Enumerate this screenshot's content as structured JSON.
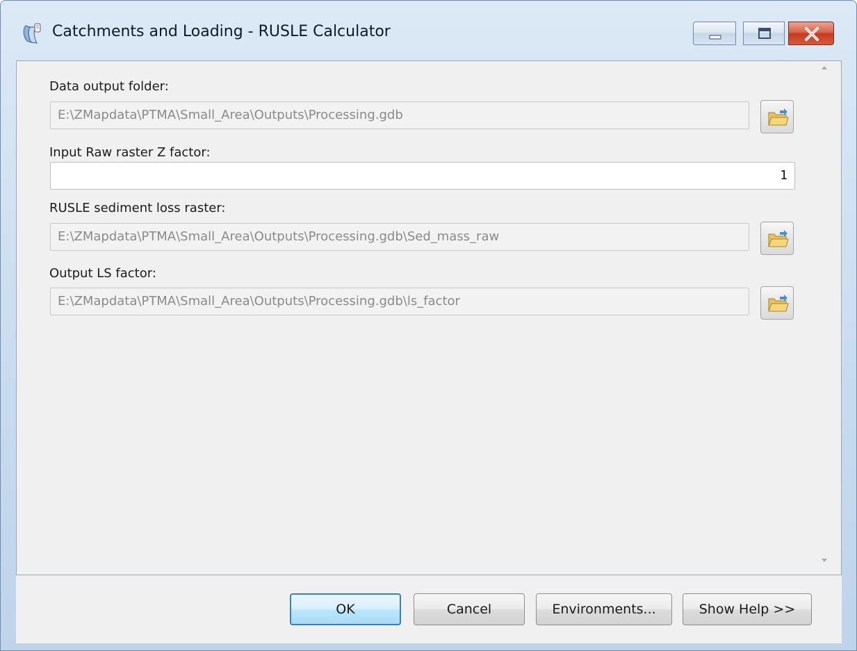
{
  "window": {
    "title": "Catchments and Loading - RUSLE Calculator",
    "icon": "toolbox-script-icon"
  },
  "title_controls": [
    "minimize-icon",
    "maximize-icon",
    "close-icon"
  ],
  "params": {
    "output_folder": {
      "label": "Data output folder:",
      "value": "E:\\ZMapdata\\PTMA\\Small_Area\\Outputs\\Processing.gdb",
      "icon": "open-folder-icon"
    },
    "z_factor": {
      "label": "Input Raw raster Z factor:",
      "value": "1"
    },
    "sediment_loss": {
      "label": "RUSLE sediment loss raster:",
      "value": "E:\\ZMapdata\\PTMA\\Small_Area\\Outputs\\Processing.gdb\\Sed_mass_raw",
      "icon": "open-folder-icon"
    },
    "ls_factor": {
      "label": "Output LS factor:",
      "value": "E:\\ZMapdata\\PTMA\\Small_Area\\Outputs\\Processing.gdb\\ls_factor",
      "icon": "open-folder-icon"
    }
  },
  "buttons": {
    "ok": "OK",
    "cancel": "Cancel",
    "environments": "Environments...",
    "help": "Show Help >>"
  },
  "colors": {
    "default_button_border": "#3c7fb1",
    "close_button": "#c43b22",
    "folder_icon": "#e8c15a"
  }
}
